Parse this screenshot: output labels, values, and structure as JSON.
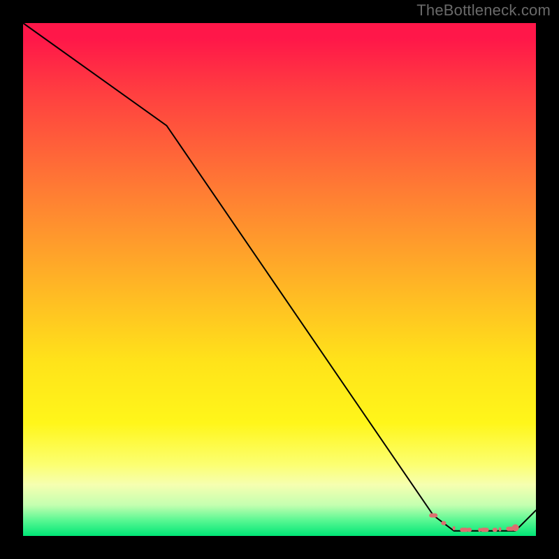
{
  "watermark": "TheBottleneck.com",
  "colors": {
    "bg": "#000000",
    "watermark": "#6a6a6a",
    "line": "#000000",
    "marker": "#dd6f6f",
    "gradient_top": "#ff1749",
    "gradient_mid_orange": "#ff9a2a",
    "gradient_mid_yellow": "#ffe31a",
    "gradient_bottom": "#00e676"
  },
  "chart_data": {
    "type": "line",
    "title": "",
    "xlabel": "",
    "ylabel": "",
    "xlim": [
      0,
      100
    ],
    "ylim": [
      0,
      100
    ],
    "grid": false,
    "series": [
      {
        "name": "bottleneck-curve",
        "x": [
          0,
          28,
          80,
          84,
          88,
          92,
          96,
          100
        ],
        "values": [
          100,
          80,
          4,
          1,
          1,
          1,
          1,
          5
        ]
      }
    ],
    "markers": {
      "name": "highlight-range",
      "x": [
        80,
        82,
        84,
        86,
        87,
        89,
        90,
        92,
        93,
        95,
        96
      ],
      "values": [
        4.0,
        2.5,
        1.5,
        1.2,
        1.2,
        1.2,
        1.2,
        1.2,
        1.3,
        1.4,
        1.6
      ],
      "style": "dots"
    },
    "legend": null
  }
}
